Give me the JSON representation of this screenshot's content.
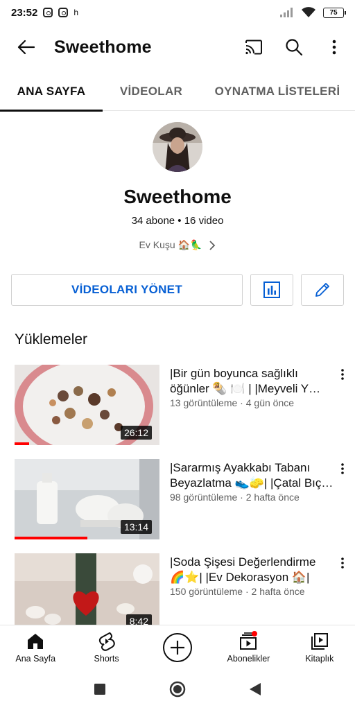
{
  "status_bar": {
    "time": "23:52",
    "extra": "h",
    "battery": "75"
  },
  "app_bar": {
    "title": "Sweethome"
  },
  "tabs": [
    {
      "label": "ANA SAYFA",
      "active": true
    },
    {
      "label": "VİDEOLAR",
      "active": false
    },
    {
      "label": "OYNATMA LİSTELERİ",
      "active": false
    }
  ],
  "channel": {
    "name": "Sweethome",
    "stats": "34 abone • 16 video",
    "link_text": "Ev Kuşu 🏠🦜"
  },
  "actions": {
    "manage_videos": "VİDEOLARI YÖNET"
  },
  "section": {
    "title": "Yüklemeler"
  },
  "videos": [
    {
      "title": "|Bir gün boyunca sağlıklı öğünler 🌯 🍽️ | |Meyveli Y…",
      "meta": "13 görüntüleme · 4 gün önce",
      "duration": "26:12",
      "progress": 0.1
    },
    {
      "title": "|Sararmış Ayakkabı Tabanı Beyazlatma 👟🧽| |Çatal Bıç…",
      "meta": "98 görüntüleme · 2 hafta önce",
      "duration": "13:14",
      "progress": 0.5
    },
    {
      "title": "|Soda Şişesi Değerlendirme 🌈⭐| |Ev Dekorasyon 🏠|",
      "meta": "150 görüntüleme · 2 hafta önce",
      "duration": "8:42",
      "progress": 0
    }
  ],
  "bottom_nav": [
    {
      "label": "Ana Sayfa",
      "icon": "home-icon"
    },
    {
      "label": "Shorts",
      "icon": "shorts-icon"
    },
    {
      "label": "",
      "icon": "create-icon"
    },
    {
      "label": "Abonelikler",
      "icon": "subscriptions-icon"
    },
    {
      "label": "Kitaplık",
      "icon": "library-icon"
    }
  ],
  "colors": {
    "accent_blue": "#065fd4",
    "red": "#ff0000",
    "text_secondary": "#606060"
  }
}
